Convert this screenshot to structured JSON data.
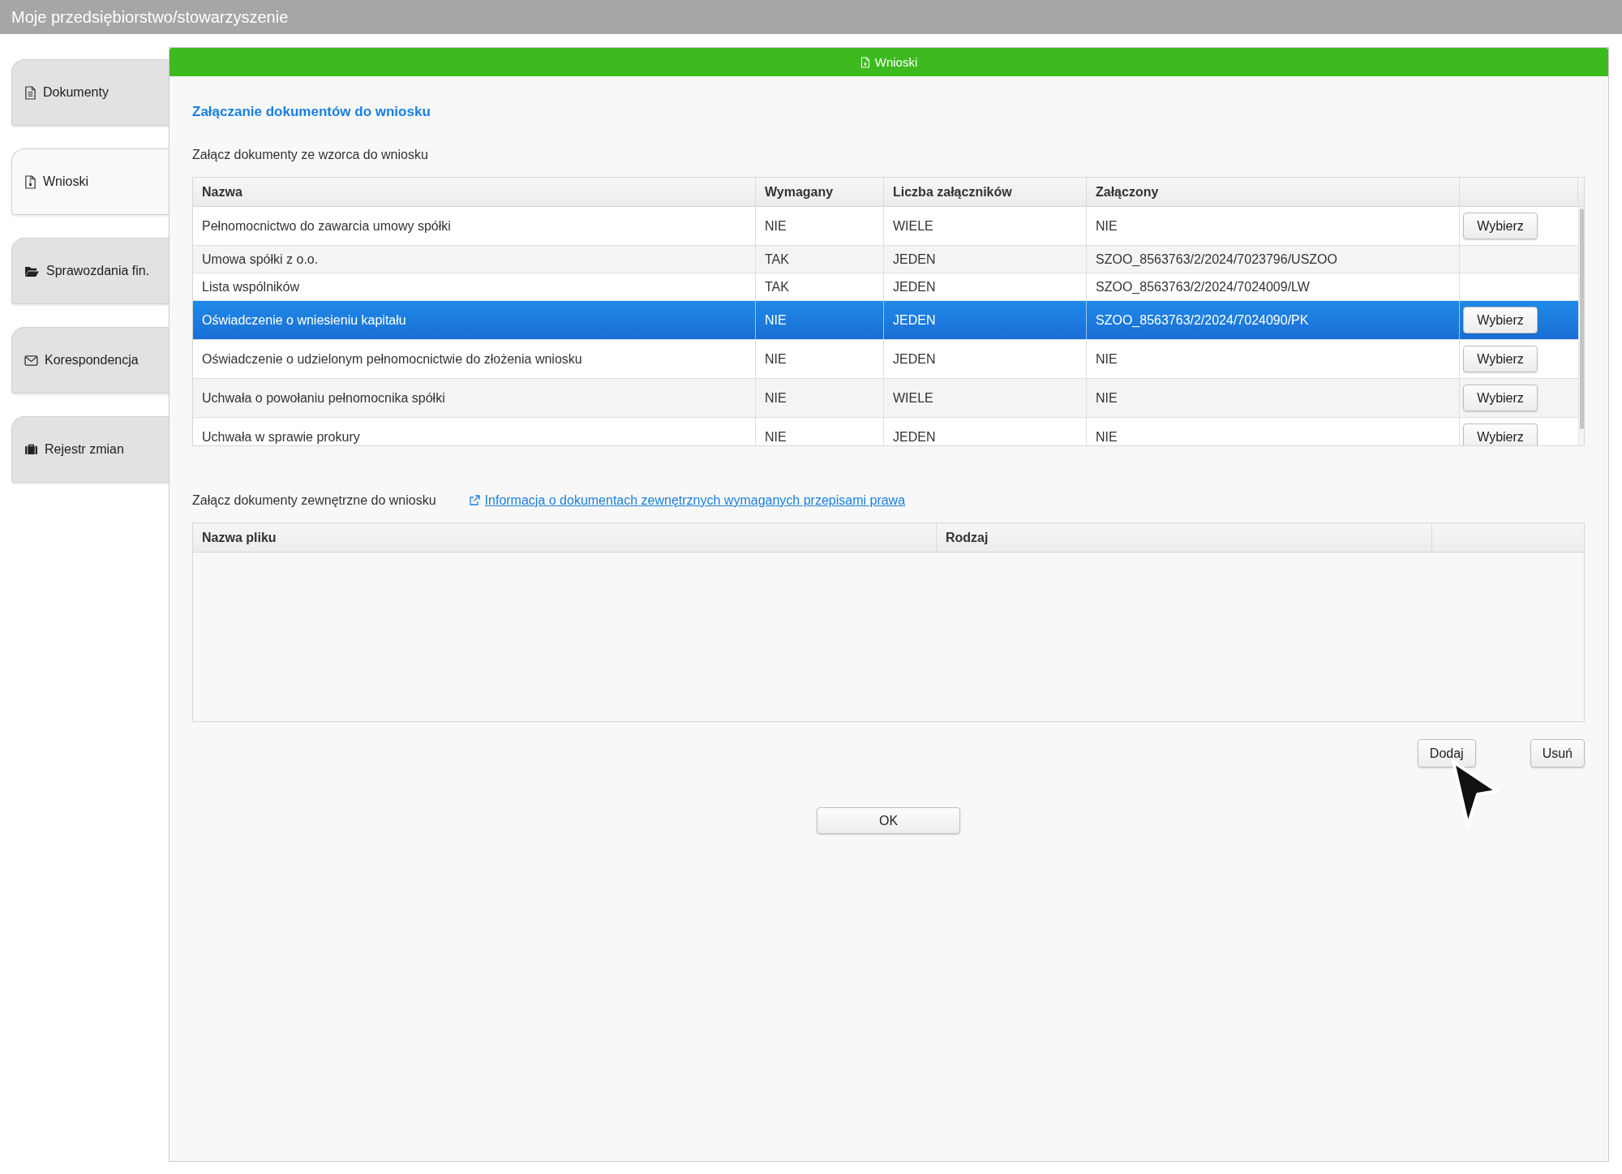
{
  "window": {
    "title": "Moje przedsiębiorstwo/stowarzyszenie"
  },
  "sidebar": {
    "items": [
      {
        "label": "Dokumenty",
        "kind": "document",
        "selected": false
      },
      {
        "label": "Wnioski",
        "kind": "application",
        "selected": true
      },
      {
        "label": "Sprawozdania fin.",
        "kind": "report",
        "selected": false
      },
      {
        "label": "Korespondencja",
        "kind": "mail",
        "selected": false
      },
      {
        "label": "Rejestr zmian",
        "kind": "register",
        "selected": false
      }
    ]
  },
  "panel": {
    "title": "Wnioski",
    "heading": "Załączanie dokumentów do wniosku",
    "template_section": {
      "label": "Załącz dokumenty ze wzorca do wniosku",
      "columns": [
        "Nazwa",
        "Wymagany",
        "Liczba załączników",
        "Załączony"
      ],
      "rows": [
        {
          "name": "Pełnomocnictwo do zawarcia umowy spółki",
          "required": "NIE",
          "count": "WIELE",
          "attached": "NIE",
          "button": "Wybierz",
          "selected": false
        },
        {
          "name": "Umowa spółki z o.o.",
          "required": "TAK",
          "count": "JEDEN",
          "attached": "SZOO_8563763/2/2024/7023796/USZOO",
          "selected": false
        },
        {
          "name": "Lista wspólników",
          "required": "TAK",
          "count": "JEDEN",
          "attached": "SZOO_8563763/2/2024/7024009/LW",
          "selected": false
        },
        {
          "name": "Oświadczenie o wniesieniu kapitału",
          "required": "NIE",
          "count": "JEDEN",
          "attached": "SZOO_8563763/2/2024/7024090/PK",
          "button": "Wybierz",
          "selected": true
        },
        {
          "name": "Oświadczenie o udzielonym pełnomocnictwie do złożenia wniosku",
          "required": "NIE",
          "count": "JEDEN",
          "attached": "NIE",
          "button": "Wybierz",
          "selected": false
        },
        {
          "name": "Uchwała o powołaniu pełnomocnika spółki",
          "required": "NIE",
          "count": "WIELE",
          "attached": "NIE",
          "button": "Wybierz",
          "selected": false
        },
        {
          "name": "Uchwała w sprawie prokury",
          "required": "NIE",
          "count": "JEDEN",
          "attached": "NIE",
          "button": "Wybierz",
          "selected": false
        }
      ]
    },
    "external_section": {
      "label": "Załącz dokumenty zewnętrzne do wniosku",
      "link": "Informacja o dokumentach zewnętrznych wymaganych przepisami prawa",
      "columns": [
        "Nazwa pliku",
        "Rodzaj"
      ]
    },
    "add_button": "Dodaj",
    "remove_button": "Usuń",
    "ok_button": "OK"
  }
}
